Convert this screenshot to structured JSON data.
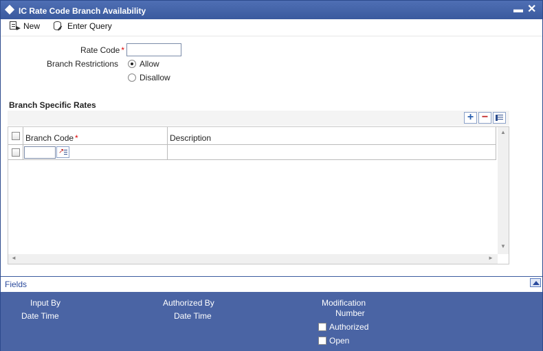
{
  "window": {
    "title": "IC Rate Code Branch Availability",
    "minimize_label": "▬",
    "close_label": "✕"
  },
  "toolbar": {
    "new_label": "New",
    "enter_query_label": "Enter Query"
  },
  "form": {
    "rate_code_label": "Rate Code",
    "rate_code_value": "",
    "required_mark": "*",
    "branch_restrictions_label": "Branch Restrictions",
    "branch_restrictions_options": [
      "Allow",
      "Disallow"
    ],
    "branch_restrictions_selected": "Allow"
  },
  "grid": {
    "title": "Branch Specific Rates",
    "columns": [
      "Branch Code",
      "Description"
    ],
    "branch_code_required": "*",
    "rows": [
      {
        "branch_code": "",
        "description": ""
      }
    ]
  },
  "footer": {
    "fields_label": "Fields",
    "input_by_label": "Input By",
    "input_datetime_label": "Date Time",
    "authorized_by_label": "Authorized By",
    "authorized_datetime_label": "Date Time",
    "modification_label": "Modification",
    "number_label": "Number",
    "authorized_checkbox_label": "Authorized",
    "open_checkbox_label": "Open"
  },
  "icons": {
    "new": "new-document-icon",
    "enter_query": "query-icon",
    "add_row": "plus-icon",
    "delete_row": "minus-icon",
    "view_row": "list-icon",
    "lov": "lov-icon"
  },
  "colors": {
    "title_bar": "#3a5a9e",
    "audit_panel": "#4a64a4",
    "required": "#dd0000",
    "link": "#2a4a9c"
  }
}
